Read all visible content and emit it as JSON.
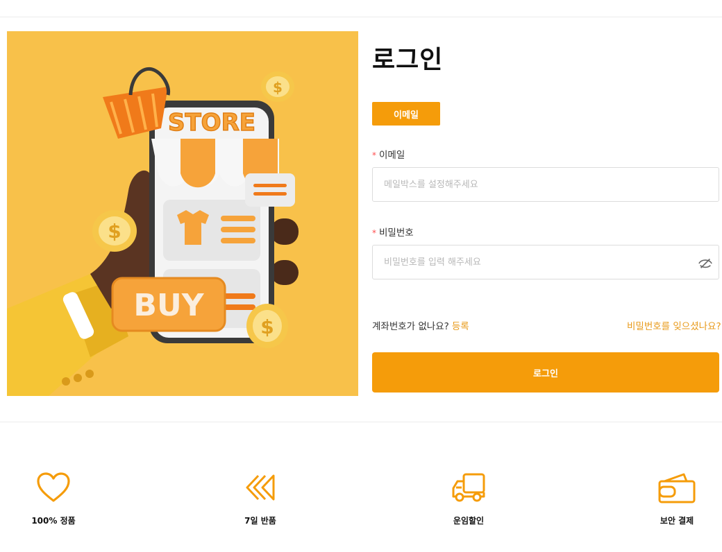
{
  "login": {
    "title": "로그인",
    "tab_email": "이메일",
    "email_label": "이메일",
    "email_placeholder": "메일박스를 설정해주세요",
    "password_label": "비밀번호",
    "password_placeholder": "비밀번호를 입력 해주세요",
    "required_mark": "*",
    "no_account_text": "계좌번호가 없나요?",
    "register_link": "등록",
    "forgot_link": "비밀번호를 잊으셨나요?",
    "submit_label": "로그인"
  },
  "hero": {
    "store_text": "STORE",
    "buy_text": "BUY",
    "coin_symbol": "$"
  },
  "features": [
    {
      "label": "100% 정품",
      "icon": "heart-icon"
    },
    {
      "label": "7일 반품",
      "icon": "rewind-icon"
    },
    {
      "label": "운임할인",
      "icon": "truck-icon"
    },
    {
      "label": "보안 결제",
      "icon": "wallet-icon"
    }
  ],
  "colors": {
    "accent": "#f59c0a",
    "link": "#e89a1a",
    "hero_background": "#f8c14a",
    "required": "#ff4d4f"
  }
}
